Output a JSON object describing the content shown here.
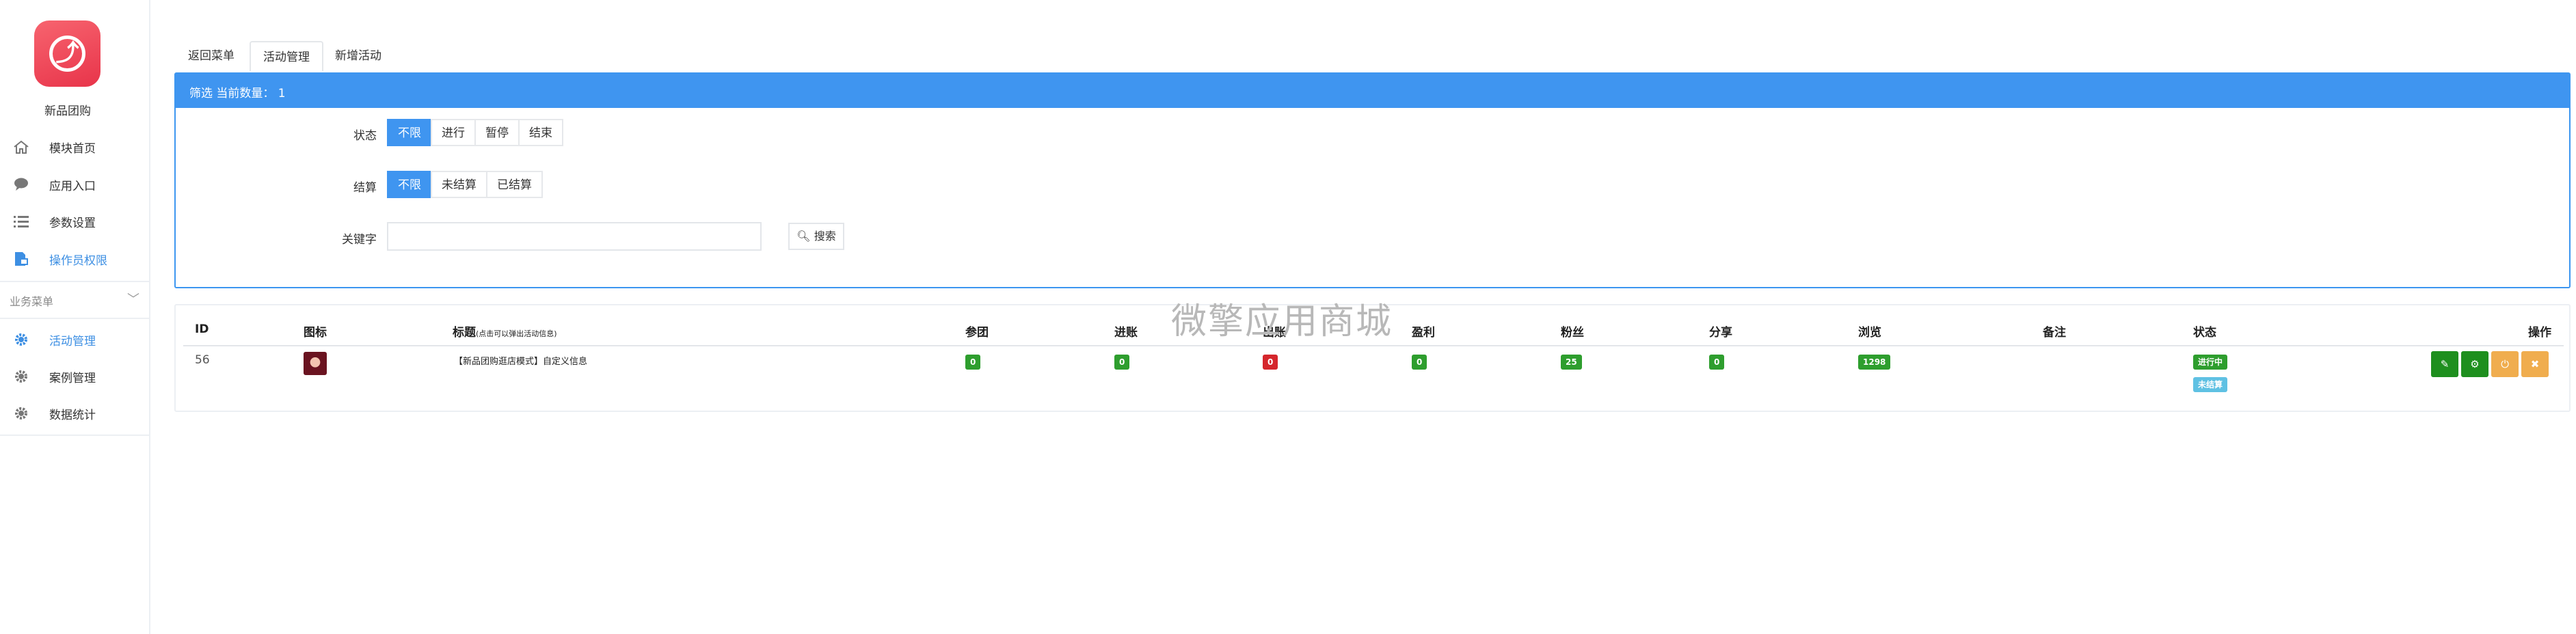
{
  "sidebar": {
    "app_name": "新品团购",
    "items": [
      {
        "label": "模块首页",
        "icon": "home-icon"
      },
      {
        "label": "应用入口",
        "icon": "chat-bubble-icon"
      },
      {
        "label": "参数设置",
        "icon": "list-icon"
      },
      {
        "label": "操作员权限",
        "icon": "document-lock-icon"
      }
    ],
    "section_title": "业务菜单",
    "section_items": [
      {
        "label": "活动管理",
        "icon": "gear-icon"
      },
      {
        "label": "案例管理",
        "icon": "gear-icon"
      },
      {
        "label": "数据统计",
        "icon": "gear-icon"
      }
    ]
  },
  "tabs": [
    "返回菜单",
    "活动管理",
    "新增活动"
  ],
  "filter": {
    "header": "筛选 当前数量： 1",
    "status_label": "状态",
    "status_options": [
      "不限",
      "进行",
      "暂停",
      "结束"
    ],
    "settle_label": "结算",
    "settle_options": [
      "不限",
      "未结算",
      "已结算"
    ],
    "keyword_label": "关键字",
    "keyword_value": "",
    "search_label": "搜索"
  },
  "table": {
    "headers": [
      "ID",
      "图标",
      "标题",
      "参团",
      "进账",
      "出账",
      "盈利",
      "粉丝",
      "分享",
      "浏览",
      "备注",
      "状态",
      "操作"
    ],
    "title_hint": "(点击可以弹出活动信息)",
    "row": {
      "id": "56",
      "title": "【新品团购逛店模式】自定义信息",
      "join": "0",
      "income": "0",
      "expense": "0",
      "profit": "0",
      "fans": "25",
      "share": "0",
      "views": "1298",
      "status_primary": "进行中",
      "status_secondary": "未结算"
    }
  },
  "watermark": "微擎应用商城",
  "colors": {
    "accent": "#3f95f0",
    "green": "#2e9e2e",
    "red": "#d5262c",
    "info": "#5fc1e3",
    "orange": "#f0ad4e"
  }
}
